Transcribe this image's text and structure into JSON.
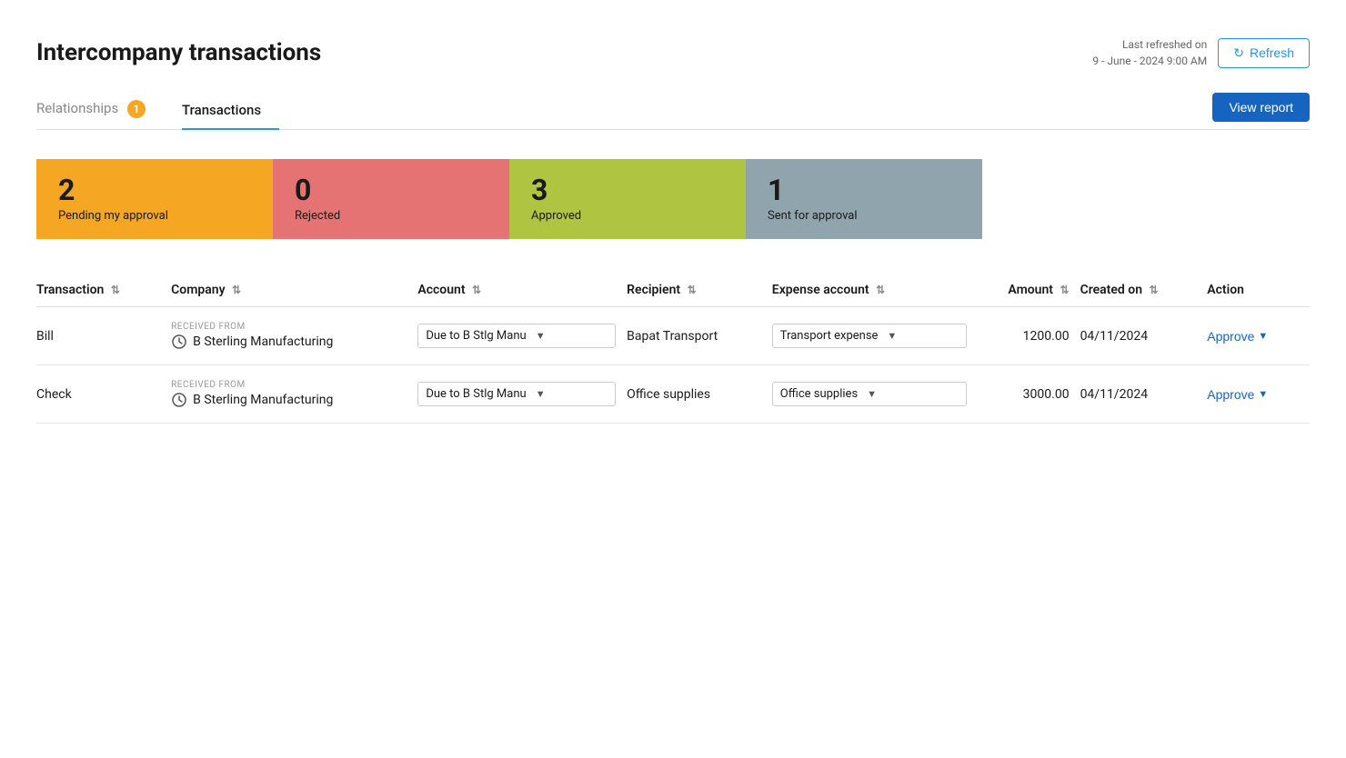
{
  "page": {
    "title": "Intercompany transactions",
    "last_refreshed_label": "Last refreshed on",
    "last_refreshed_time": "9 - June - 2024 9:00 AM"
  },
  "buttons": {
    "refresh": "Refresh",
    "view_report": "View report"
  },
  "tabs": [
    {
      "id": "relationships",
      "label": "Relationships",
      "badge": "1",
      "active": false
    },
    {
      "id": "transactions",
      "label": "Transactions",
      "badge": null,
      "active": true
    }
  ],
  "status_cards": [
    {
      "id": "pending",
      "count": "2",
      "label": "Pending my approval",
      "type": "pending"
    },
    {
      "id": "rejected",
      "count": "0",
      "label": "Rejected",
      "type": "rejected"
    },
    {
      "id": "approved",
      "count": "3",
      "label": "Approved",
      "type": "approved"
    },
    {
      "id": "sent",
      "count": "1",
      "label": "Sent for approval",
      "type": "sent"
    }
  ],
  "table": {
    "columns": [
      {
        "id": "transaction",
        "label": "Transaction",
        "sortable": true
      },
      {
        "id": "company",
        "label": "Company",
        "sortable": true
      },
      {
        "id": "account",
        "label": "Account",
        "sortable": true
      },
      {
        "id": "recipient",
        "label": "Recipient",
        "sortable": true
      },
      {
        "id": "expense_account",
        "label": "Expense account",
        "sortable": true
      },
      {
        "id": "amount",
        "label": "Amount",
        "sortable": true
      },
      {
        "id": "created_on",
        "label": "Created on",
        "sortable": true
      },
      {
        "id": "action",
        "label": "Action",
        "sortable": false
      }
    ],
    "rows": [
      {
        "id": "row1",
        "transaction": "Bill",
        "received_from_label": "RECEIVED FROM",
        "company": "B Sterling Manufacturing",
        "account": "Due to B Stlg Manu",
        "recipient": "Bapat Transport",
        "expense_account": "Transport expense",
        "amount": "1200.00",
        "created_on": "04/11/2024",
        "action": "Approve"
      },
      {
        "id": "row2",
        "transaction": "Check",
        "received_from_label": "RECEIVED FROM",
        "company": "B Sterling Manufacturing",
        "account": "Due to B Stlg Manu",
        "recipient": "Office supplies",
        "expense_account": "Office supplies",
        "amount": "3000.00",
        "created_on": "04/11/2024",
        "action": "Approve"
      }
    ]
  }
}
